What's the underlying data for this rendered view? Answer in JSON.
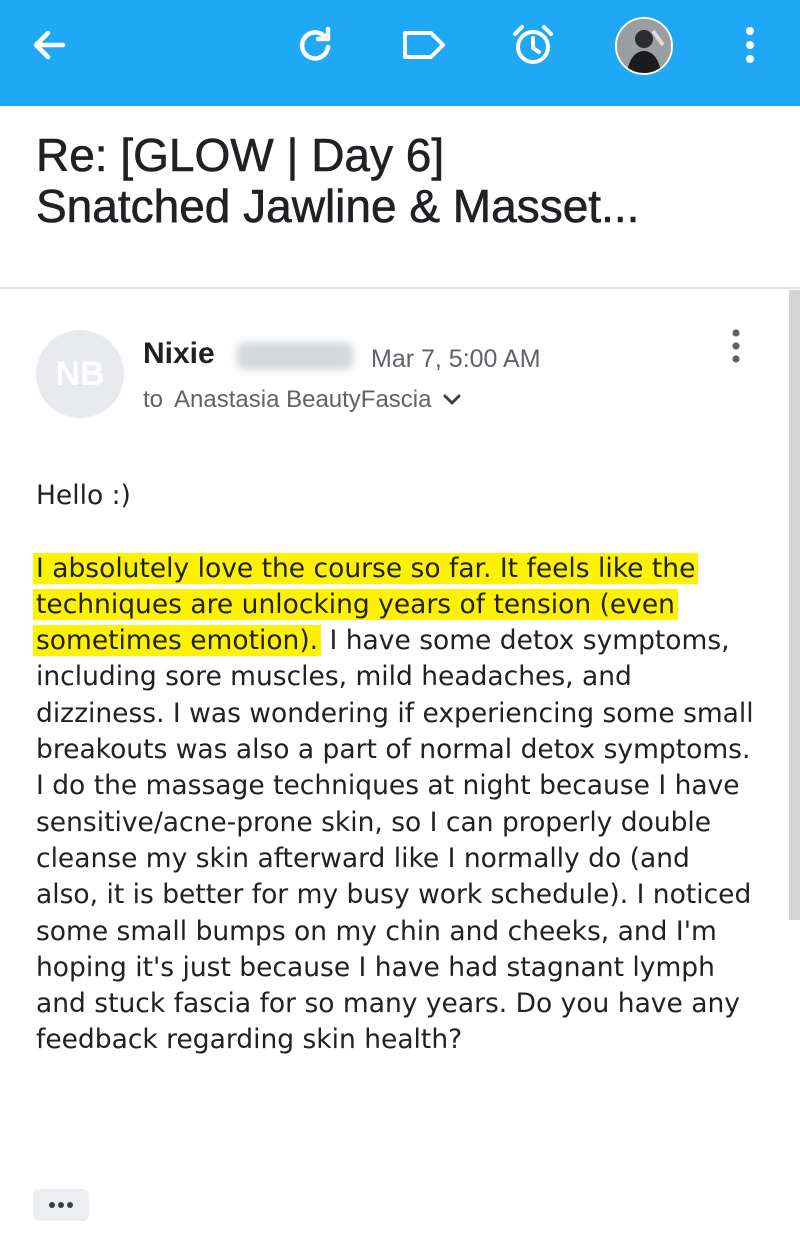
{
  "appbar": {
    "background": "#1fa8f5",
    "icons": [
      "back-arrow-icon",
      "refresh-icon",
      "label-icon",
      "snooze-alarm-icon",
      "overflow-menu-icon"
    ]
  },
  "subject": {
    "line1": "Re: [GLOW | Day 6]",
    "line2": "Snatched Jawline & Masset..."
  },
  "sender": {
    "initials": "NB",
    "name": "Nixie",
    "date": "Mar 7, 5:00 AM",
    "to_label": "to",
    "recipient": "Anastasia BeautyFascia"
  },
  "message": {
    "greeting": "Hello :)",
    "highlighted": "I absolutely love the course so far. It feels like the techniques are unlocking years of tension (even sometimes emotion).",
    "rest": " I have some detox symptoms, including sore muscles, mild headaches, and dizziness. I was wondering if experiencing some small breakouts was also a part of normal detox symptoms. I do the massage techniques at night because I have sensitive/acne-prone skin, so I can properly double cleanse my skin afterward like I normally do (and also, it is better for my busy work schedule). I noticed some small bumps on my chin and cheeks, and I'm hoping it's just because I have had stagnant lymph and stuck fascia for so many years. Do you have any feedback regarding skin health?",
    "highlight_color": "#fff200"
  },
  "trimmed_content_label": "•••"
}
